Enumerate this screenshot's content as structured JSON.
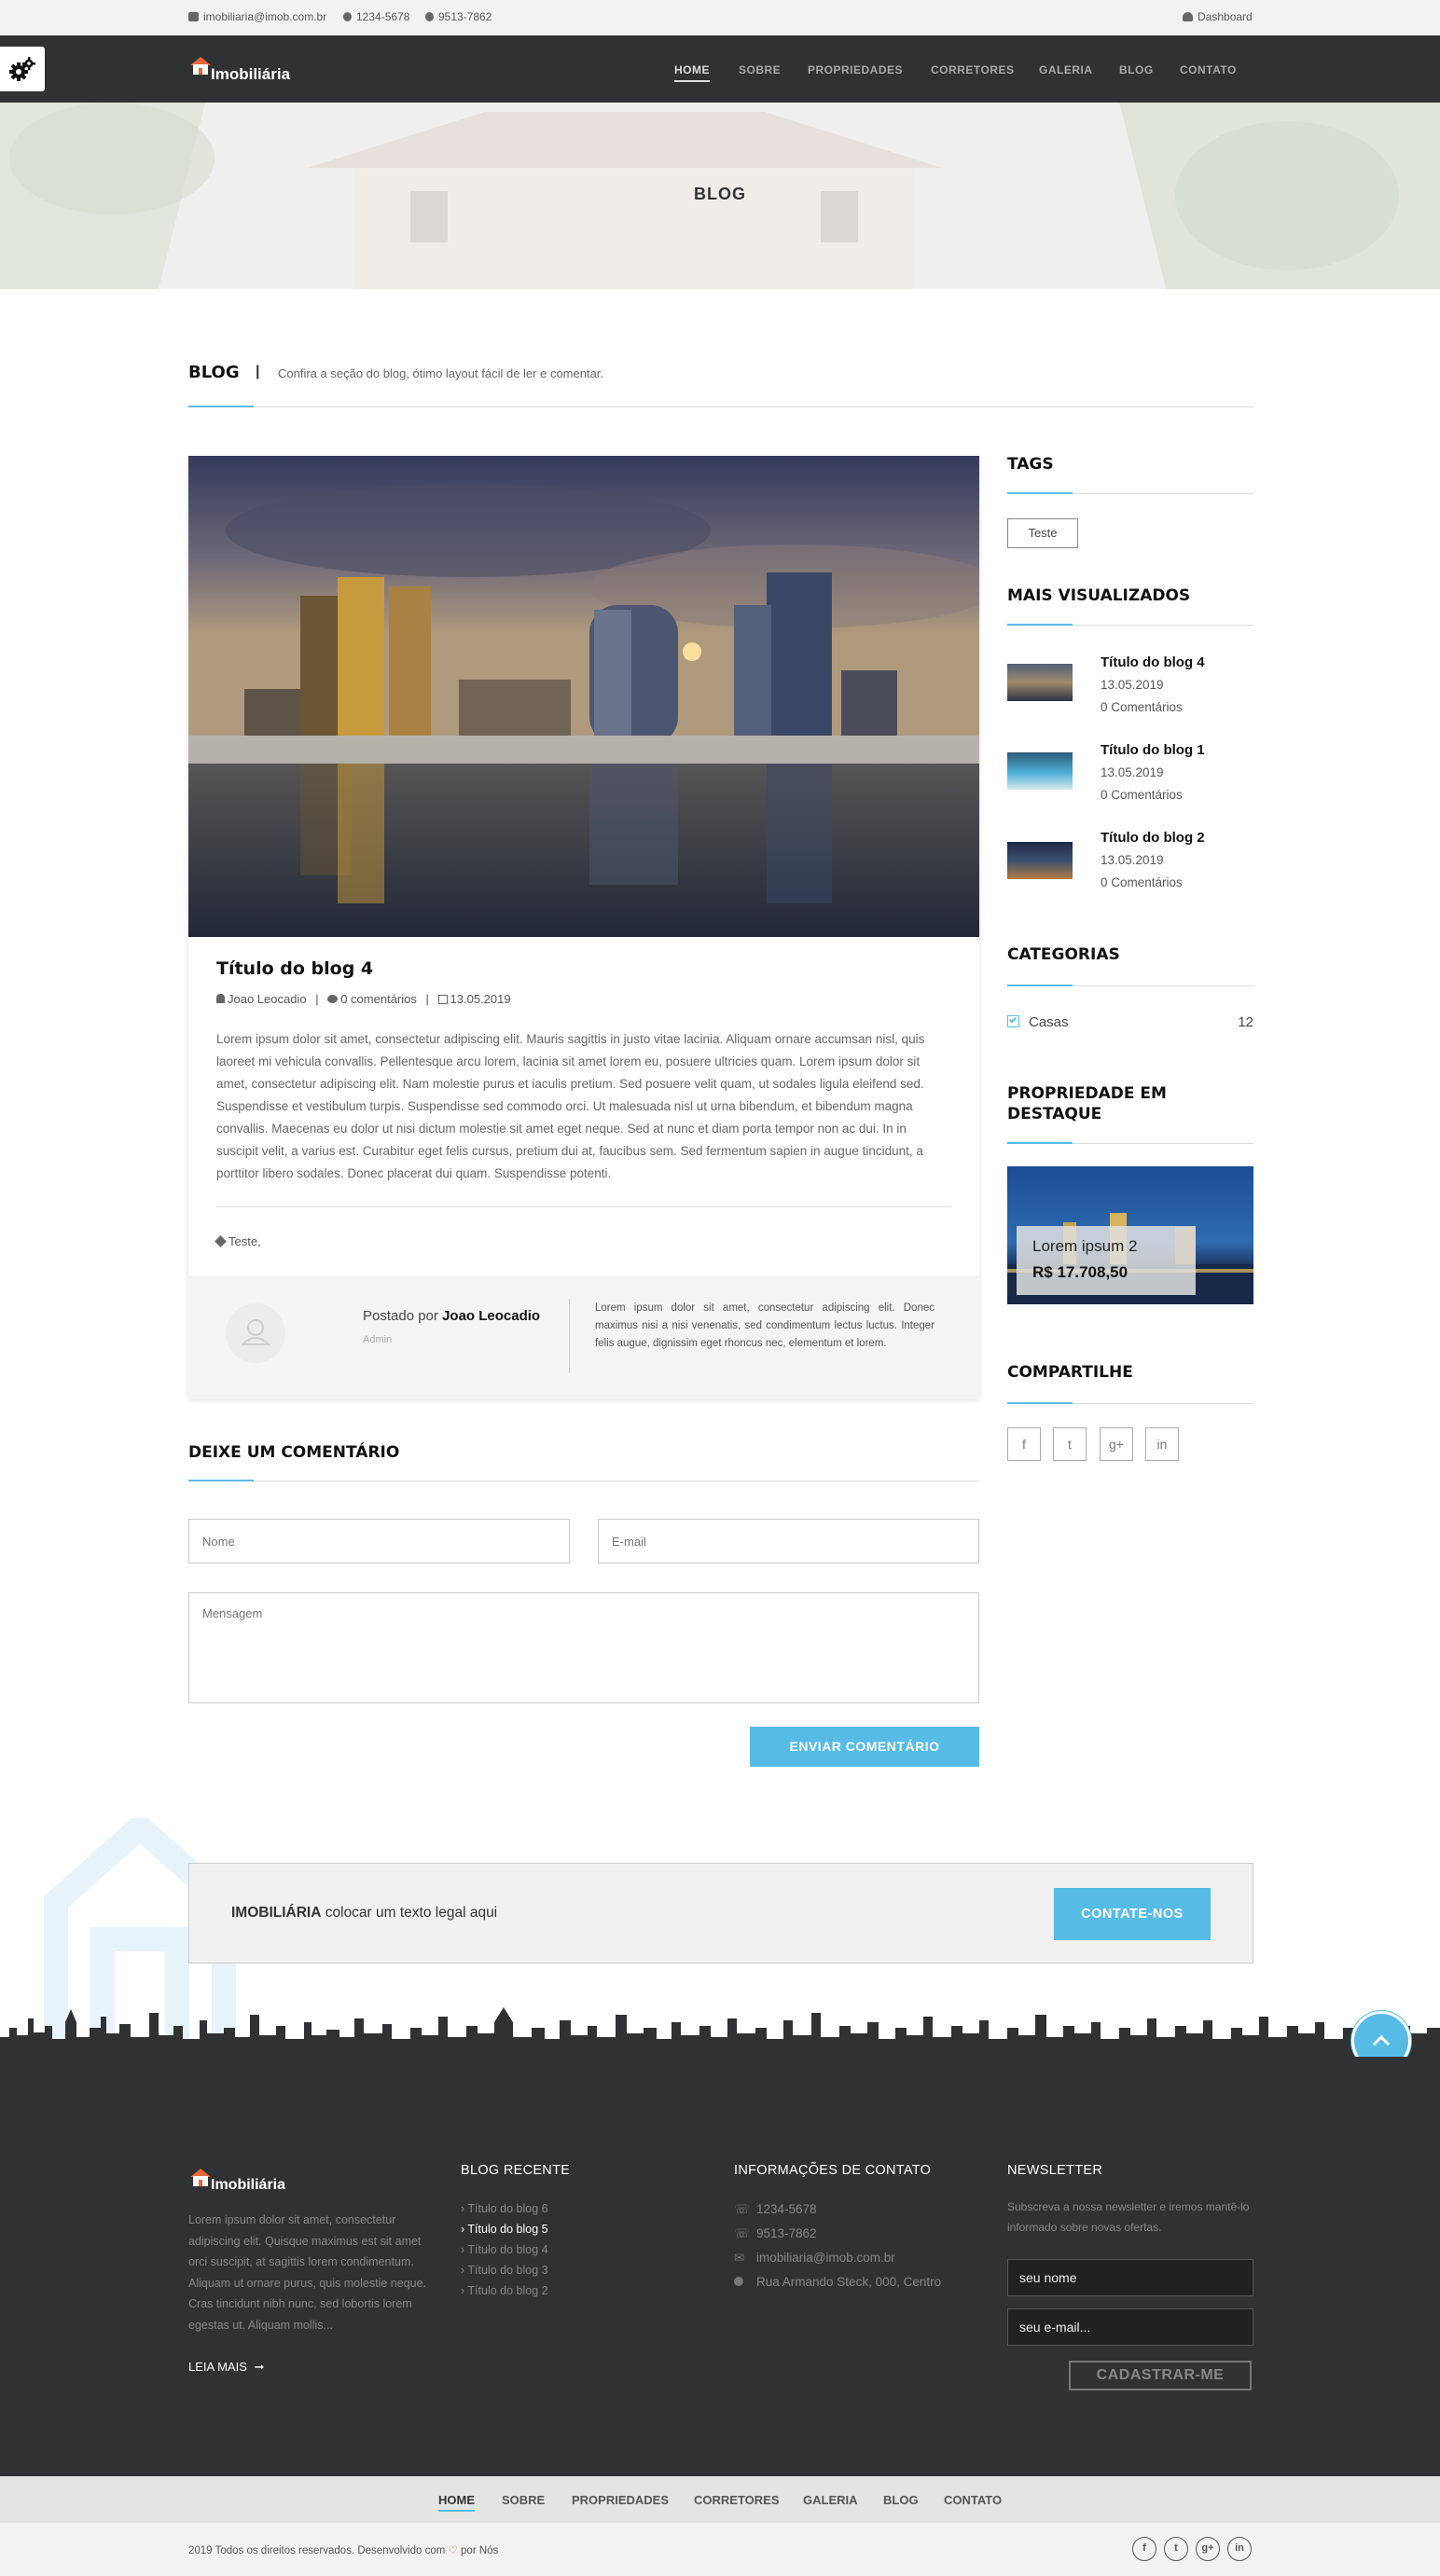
{
  "topbar": {
    "email": "imobiliaria@imob.com.br",
    "phone1": "1234-5678",
    "phone2": "9513-7862",
    "dashboard": "Dashboard"
  },
  "header": {
    "logo": "Imobiliária",
    "menu": [
      "HOME",
      "SOBRE",
      "PROPRIEDADES",
      "CORRETORES",
      "GALERIA",
      "BLOG",
      "CONTATO"
    ]
  },
  "hero": {
    "title": "BLOG"
  },
  "section": {
    "title": "BLOG",
    "separator": "|",
    "subtitle": "Confira a seção do blog, ótimo layout fácil de ler e comentar."
  },
  "post": {
    "title": "Título do blog 4",
    "author": "Joao Leocadio",
    "comments": "0 comentários",
    "date": "13.05.2019",
    "meta_sep": "|",
    "body": "Lorem ipsum dolor sit amet, consectetur adipiscing elit. Mauris sagittis in justo vitae lacinia. Aliquam ornare accumsan nisl, quis laoreet mi vehicula convallis. Pellentesque arcu lorem, lacinia sit amet lorem eu, posuere ultricies quam. Lorem ipsum dolor sit amet, consectetur adipiscing elit. Nam molestie purus et iaculis pretium. Sed posuere velit quam, ut sodales ligula eleifend sed. Suspendisse et vestibulum turpis. Suspendisse sed commodo orci. Ut malesuada nisl ut urna bibendum, et bibendum magna convallis. Maecenas eu dolor ut nisi dictum molestie sit amet eget neque. Sed at nunc et diam porta tempor non ac dui. In in suscipit velit, a varius est. Curabitur eget felis cursus, pretium dui at, faucibus sem. Sed fermentum sapien in augue tincidunt, a porttitor libero sodales. Donec placerat dui quam. Suspendisse potenti.",
    "tags": "Teste,",
    "posted_by_label": "Postado por",
    "posted_by_name": "Joao Leocadio",
    "role": "Admin",
    "author_bio": "Lorem ipsum dolor sit amet, consectetur adipiscing elit. Donec maximus nisi a nisi venenatis, sed condimentum lectus luctus. Integer felis augue, dignissim eget rhoncus nec, elementum et lorem."
  },
  "comment_form": {
    "title": "DEIXE UM COMENTÁRIO",
    "name_placeholder": "Nome",
    "email_placeholder": "E-mail",
    "message_placeholder": "Mensagem",
    "submit": "ENVIAR COMENTÁRIO"
  },
  "sidebar": {
    "tags_title": "TAGS",
    "tag": "Teste",
    "most_viewed_title": "MAIS VISUALIZADOS",
    "most_viewed": [
      {
        "title": "Título do blog 4",
        "date": "13.05.2019",
        "comments": "0 Comentários"
      },
      {
        "title": "Título do blog 1",
        "date": "13.05.2019",
        "comments": "0 Comentários"
      },
      {
        "title": "Título do blog 2",
        "date": "13.05.2019",
        "comments": "0 Comentários"
      }
    ],
    "categories_title": "CATEGORIAS",
    "category": {
      "name": "Casas",
      "count": "12"
    },
    "featured_title": "PROPRIEDADE EM DESTAQUE",
    "featured": {
      "name": "Lorem ipsum 2",
      "price": "R$ 17.708,50"
    },
    "share_title": "COMPARTILHE",
    "share_icons": [
      "f",
      "t",
      "g+",
      "in"
    ]
  },
  "cta": {
    "brand": "IMOBILIÁRIA",
    "text": "colocar um texto legal aqui",
    "button": "CONTATE-NOS"
  },
  "footer": {
    "logo": "Imobiliária",
    "about": "Lorem ipsum dolor sit amet, consectetur adipiscing elit. Quisque maximus est sit amet orci suscipit, at sagittis lorem condimentum. Aliquam ut ornare purus, quis molestie neque. Cras tincidunt nibh nunc, sed lobortis lorem egestas ut. Aliquam mollis...",
    "read_more": "LEIA MAIS",
    "recent_title": "BLOG RECENTE",
    "recent": [
      "Título do blog 6",
      "Título do blog 5",
      "Título do blog 4",
      "Título do blog 3",
      "Título do blog 2"
    ],
    "contact_title": "INFORMAÇÕES DE CONTATO",
    "contact": [
      "1234-5678",
      "9513-7862",
      "imobiliaria@imob.com.br",
      "Rua Armando Steck, 000, Centro"
    ],
    "newsletter_title": "NEWSLETTER",
    "newsletter_text": "Subscreva a nossa newsletter e iremos mantê-lo informado sobre novas ofertas.",
    "name_value": "seu nome",
    "email_value": "seu e-mail...",
    "subscribe": "CADASTRAR-ME"
  },
  "bottom_nav": [
    "HOME",
    "SOBRE",
    "PROPRIEDADES",
    "CORRETORES",
    "GALERIA",
    "BLOG",
    "CONTATO"
  ],
  "copyright": {
    "text": "2019 Todos os direitos reservados. Desenvolvido com",
    "suffix": "por Nós"
  },
  "social_icons": [
    "f",
    "t",
    "g+",
    "in"
  ],
  "colors": {
    "accent": "#56bce6",
    "dark": "#303133",
    "tag_orange": "#e8663a"
  }
}
